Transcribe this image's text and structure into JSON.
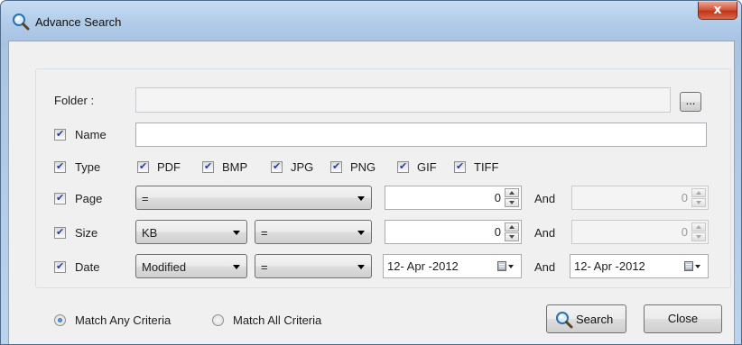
{
  "window": {
    "title": "Advance Search",
    "close_glyph": "x"
  },
  "folder": {
    "label": "Folder :",
    "value": "",
    "browse_label": "..."
  },
  "name": {
    "label": "Name",
    "checked": true,
    "value": ""
  },
  "type": {
    "label": "Type",
    "checked": true,
    "options": [
      {
        "label": "PDF",
        "checked": true
      },
      {
        "label": "BMP",
        "checked": true
      },
      {
        "label": "JPG",
        "checked": true
      },
      {
        "label": "PNG",
        "checked": true
      },
      {
        "label": "GIF",
        "checked": true
      },
      {
        "label": "TIFF",
        "checked": true
      }
    ]
  },
  "page": {
    "label": "Page",
    "checked": true,
    "operator": "=",
    "value_from": "0",
    "and_label": "And",
    "value_to": "0"
  },
  "size": {
    "label": "Size",
    "checked": true,
    "unit": "KB",
    "operator": "=",
    "value_from": "0",
    "and_label": "And",
    "value_to": "0"
  },
  "date": {
    "label": "Date",
    "checked": true,
    "field": "Modified",
    "operator": "=",
    "value_from": "12- Apr -2012",
    "and_label": "And",
    "value_to": "12- Apr -2012"
  },
  "criteria": {
    "any_label": "Match Any Criteria",
    "any_selected": true,
    "all_label": "Match All Criteria",
    "all_selected": false
  },
  "buttons": {
    "search_label": "Search",
    "close_label": "Close"
  },
  "icons": {
    "title": "search-icon",
    "search": "magnifier-icon",
    "calendar": "calendar-icon"
  },
  "colors": {
    "titlebar": "#b0cbe8",
    "close": "#c23418",
    "client": "#f0f0f0"
  }
}
